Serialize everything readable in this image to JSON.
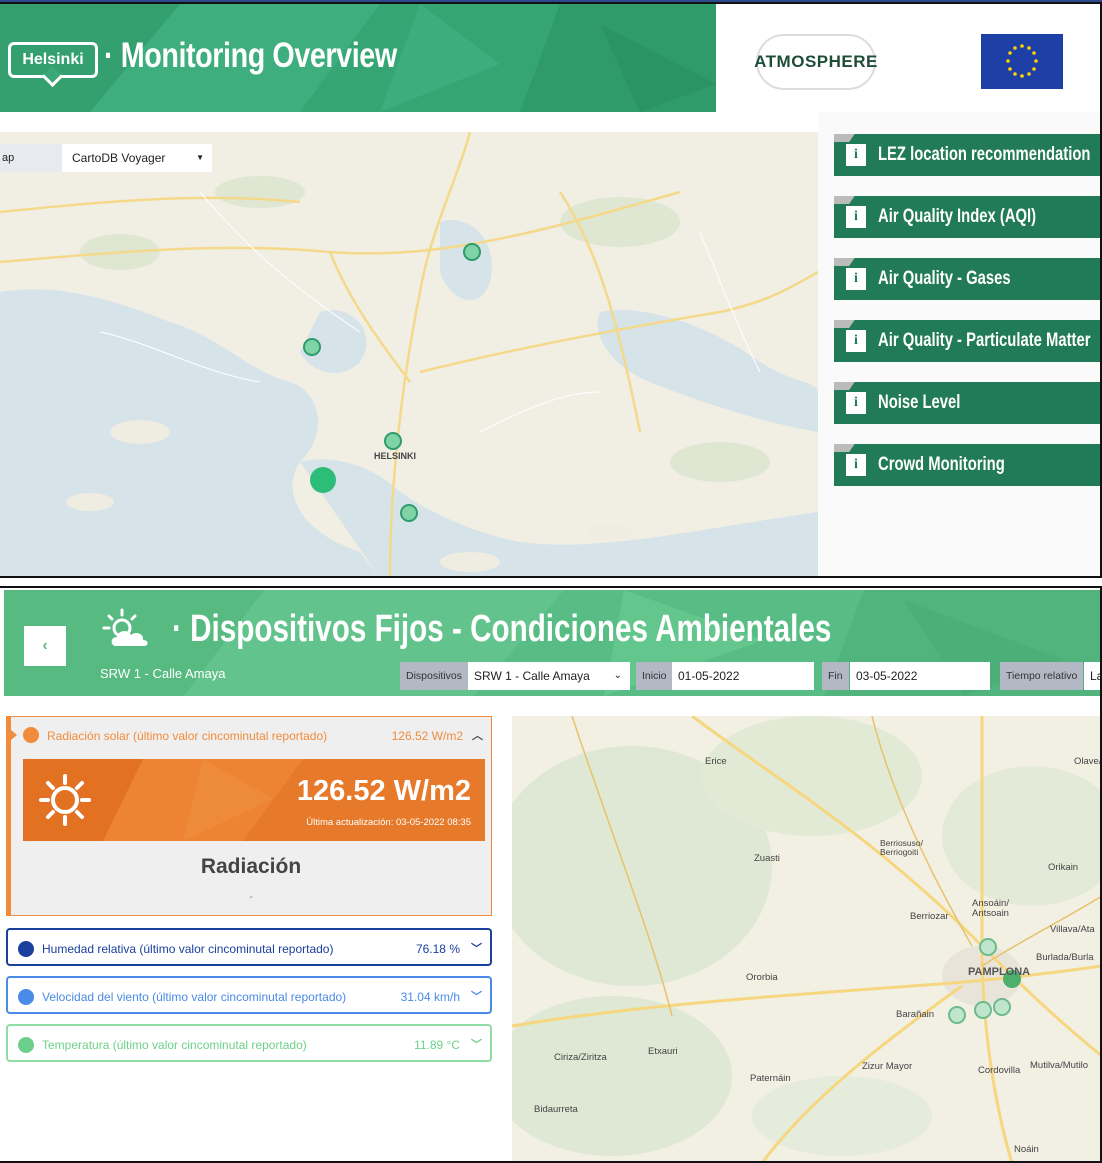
{
  "monitoring": {
    "brand": "Helsinki",
    "title": "· Monitoring Overview",
    "partner_logo": "ATMOSPHERE",
    "eu_flag": "eu-flag-icon",
    "map": {
      "layer_label": "ap",
      "layer_value": "CartoDB Voyager",
      "city_label": "HELSINKI"
    },
    "sidebar": [
      {
        "label": "LEZ location recommendation",
        "icon": "info-icon"
      },
      {
        "label": "Air Quality Index (AQI)",
        "icon": "info-icon"
      },
      {
        "label": "Air Quality - Gases",
        "icon": "info-icon"
      },
      {
        "label": "Air Quality - Particulate Matter",
        "icon": "info-icon"
      },
      {
        "label": "Noise Level",
        "icon": "info-icon"
      },
      {
        "label": "Crowd Monitoring",
        "icon": "info-icon"
      }
    ]
  },
  "devices": {
    "title": "· Dispositivos Fijos - Condiciones Ambientales",
    "subtitle": "SRW 1 - Calle Amaya",
    "back_icon": "‹",
    "controls": {
      "device_label": "Dispositivos",
      "device_value": "SRW 1 - Calle Amaya",
      "start_label": "Inicio",
      "start_value": "01-05-2022",
      "end_label": "Fin",
      "end_value": "03-05-2022",
      "relative_label": "Tiempo relativo",
      "relative_value": "La"
    },
    "sensors": {
      "solar": {
        "label": "Radiación solar (último valor cincominutal reportado)",
        "value": "126.52 W/m2",
        "big_value": "126.52 W/m2",
        "updated": "Última actualización: 03-05-2022 08:35",
        "name": "Radiación",
        "dash": "-",
        "color": "#f08c3c"
      },
      "humidity": {
        "label": "Humedad relativa (último valor cincominutal reportado)",
        "value": "76.18 %",
        "color": "#1a3f9c"
      },
      "wind": {
        "label": "Velocidad del viento (último valor cincominutal reportado)",
        "value": "31.04 km/h",
        "color": "#4a8ae8"
      },
      "temp": {
        "label": "Temperatura (último valor cincominutal reportado)",
        "value": "11.89 °C",
        "color": "#6dd08a"
      }
    },
    "map_labels": {
      "erice": "Erice",
      "olave": "Olave/",
      "zuasti": "Zuasti",
      "berriosuso": "Berriosuso/",
      "berriogoiti": "Berriogoiti",
      "orikain": "Orikain",
      "ansoain": "Ansoáin/",
      "antsoain": "Antsoain",
      "berriozar": "Berriozar",
      "villava": "Villava/Ata",
      "burlada": "Burlada/Burla",
      "pamplona": "PAMPLONA",
      "orcoyen": "Ororbia",
      "baranain": "Barañain",
      "ciriza": "Ciriza/Ziritza",
      "etxauri": "Etxauri",
      "zizur": "Zizur Mayor",
      "cordovilla": "Cordovilla",
      "mutilva": "Mutilva/Mutilo",
      "paternain": "Paternáin",
      "bidaurreta": "Bidaurreta",
      "noain": "Noáin"
    }
  }
}
